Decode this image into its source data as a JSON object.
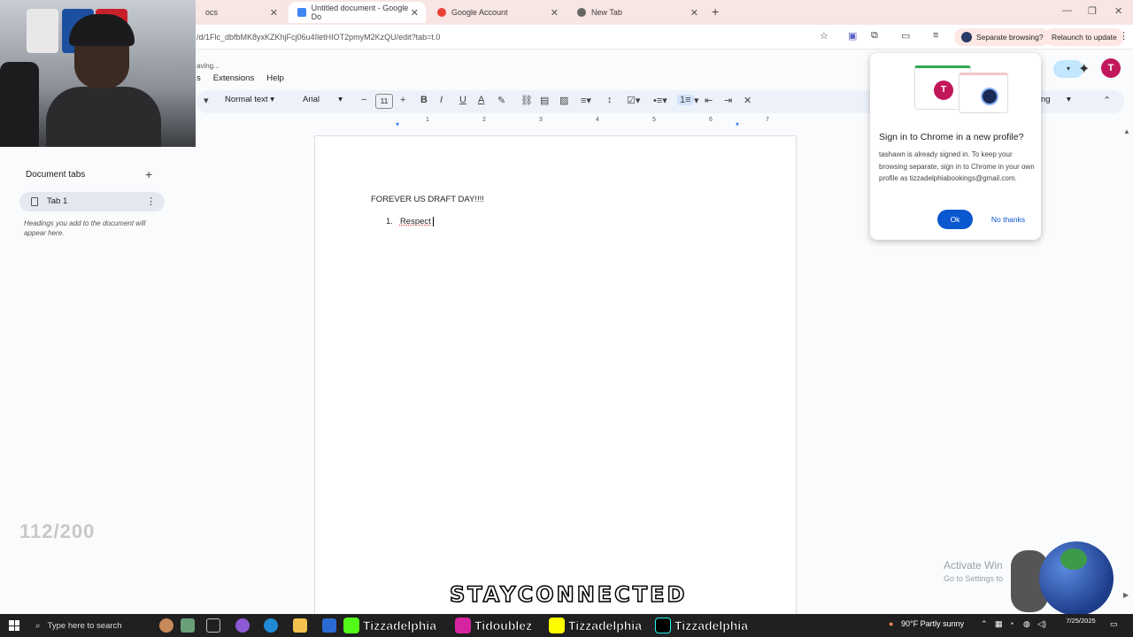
{
  "browser": {
    "tabs": [
      {
        "label": "ocs",
        "active": false
      },
      {
        "label": "Untitled document - Google Do",
        "active": true
      },
      {
        "label": "Google Account",
        "active": false
      },
      {
        "label": "New Tab",
        "active": false
      }
    ],
    "url": "/d/1Flc_dbfbMK8yxKZKhjFcj06u4IletHIOT2pmyM2KzQU/edit?tab=t.0",
    "separate_browsing_label": "Separate browsing?",
    "relaunch_label": "Relaunch to update"
  },
  "docs": {
    "saving_status": "aving...",
    "menu": [
      "s",
      "Extensions",
      "Help"
    ],
    "toolbar": {
      "style_select": "Normal text",
      "font_select": "Arial",
      "font_size": "11",
      "editing_mode": "ng"
    },
    "ruler_numbers": [
      "1",
      "2",
      "3",
      "4",
      "5",
      "6",
      "7"
    ],
    "account_initial": "T"
  },
  "side_panel": {
    "title": "Document tabs",
    "tab_label": "Tab 1",
    "hint": "Headings you add to the document will appear here."
  },
  "document": {
    "heading": "FOREVER US DRAFT DAY!!!!",
    "list_number": "1.",
    "list_item": "Respect"
  },
  "profile_popup": {
    "avatar_initial": "T",
    "title": "Sign in to Chrome in a new profile?",
    "body": "tashawn is already signed in. To keep your browsing separate, sign in to Chrome in your own profile as tizzadelphiabookings@gmail.com.",
    "ok_label": "Ok",
    "no_label": "No thanks"
  },
  "overlay": {
    "counter": "112/200",
    "banner": "STAYCONNECTED",
    "activate_title": "Activate Win",
    "activate_sub": "Go to Settings to"
  },
  "taskbar": {
    "search_placeholder": "Type here to search",
    "socials": [
      {
        "name": "kick",
        "handle": "Tizzadelphia",
        "color": "#53fc18"
      },
      {
        "name": "instagram",
        "handle": "Tidoublez",
        "color": "#d6249f"
      },
      {
        "name": "snapchat",
        "handle": "Tizzadelphia",
        "color": "#fffc00"
      },
      {
        "name": "tiktok",
        "handle": "Tizzadelphia",
        "color": "#000000"
      }
    ],
    "weather": "90°F  Partly sunny",
    "time": "",
    "date": "7/25/2025"
  },
  "colors": {
    "accent_blue": "#0b57d0",
    "tabstrip": "#f8e6e4",
    "avatar": "#c2185b"
  }
}
